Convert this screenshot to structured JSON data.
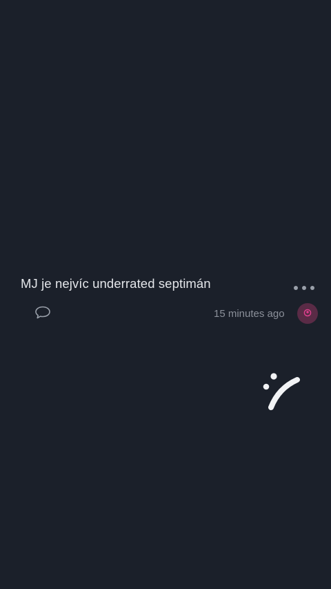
{
  "post": {
    "text": "MJ je nejvíc underrated septimán",
    "timestamp": "15 minutes ago",
    "more_icon": "ellipsis-icon",
    "reply_icon": "speech-bubble-icon",
    "avatar_icon": "user-avatar-icon"
  },
  "colors": {
    "background": "#1b202a",
    "text": "#e4e6ea",
    "muted": "#8b909a",
    "avatar_bg": "#5a2b46",
    "avatar_accent": "#e0408f"
  }
}
